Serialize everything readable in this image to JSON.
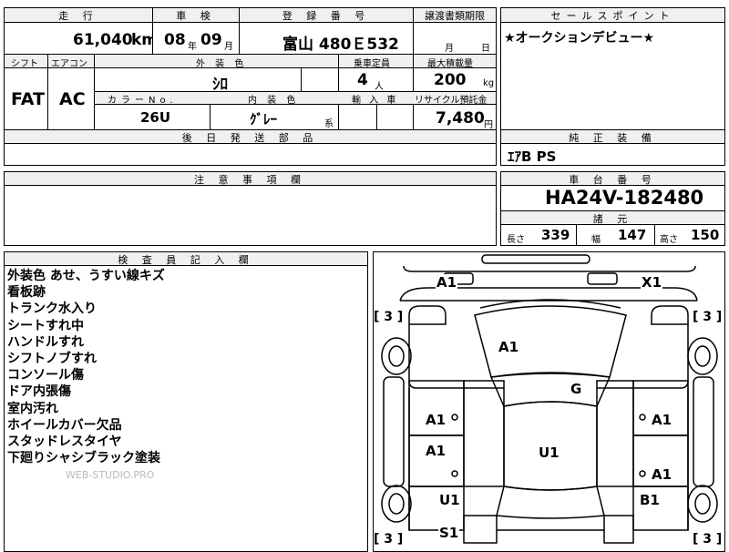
{
  "top_row": {
    "mileage_label": "走 行",
    "mileage_value": "61,040",
    "mileage_unit": "km",
    "inspection_label": "車 検",
    "insp_year": "08",
    "insp_year_unit": "年",
    "insp_month": "09",
    "insp_month_unit": "月",
    "registration_label": "登 録 番 号",
    "registration_value": "富山 480Ｅ532",
    "transfer_label": "譲渡書類期限",
    "transfer_month_unit": "月",
    "transfer_day_unit": "日"
  },
  "sales_points": {
    "label": "セールスポイント",
    "text": "★オークションデビュー★"
  },
  "second_block": {
    "shift_label": "シフト",
    "shift_value": "FAT",
    "ac_label": "エアコン",
    "ac_value": "AC",
    "ext_color_label": "外 装 色",
    "ext_color_value": "ｼﾛ",
    "capacity_label": "乗車定員",
    "capacity_value": "4",
    "capacity_unit": "人",
    "load_label": "最大積載量",
    "load_value": "200",
    "load_unit": "kg",
    "color_no_label": "カラーNo.",
    "color_no_value": "26U",
    "int_color_label": "内 装 色",
    "int_color_value": "ｸﾞﾚｰ",
    "int_color_suffix": "系",
    "import_label": "輸 入 車",
    "recycle_label": "リサイクル預託金",
    "recycle_value": "7,480",
    "recycle_unit": "円"
  },
  "parts": {
    "label": "後 日 発 送 部 品"
  },
  "equipment": {
    "label": "純 正 装 備",
    "value": "ｴｱB PS"
  },
  "caution": {
    "label": "注 意 事 項 欄"
  },
  "chassis": {
    "label": "車 台 番 号",
    "value": "HA24V-182480"
  },
  "specs": {
    "label": "諸 元",
    "length_label": "長さ",
    "length_value": "339",
    "width_label": "幅",
    "width_value": "147",
    "height_label": "高さ",
    "height_value": "150"
  },
  "inspector": {
    "label": "検 査 員 記 入 欄",
    "notes": [
      "外装色 あせ、うすい線キズ",
      "看板跡",
      "トランク水入り",
      "シートすれ中",
      "ハンドルすれ",
      "シフトノブすれ",
      "コンソール傷",
      "ドア内張傷",
      "室内汚れ",
      "ホイールカバー欠品",
      "スタッドレスタイヤ",
      "下廻りシャシブラック塗装"
    ],
    "watermark": "WEB-STUDIO.PRO"
  },
  "diagram": {
    "grades": {
      "front_left": "A1",
      "front_right": "X1",
      "hood": "A1",
      "windshield": "G",
      "front_door_left": "A1",
      "front_door_right": "A1",
      "rear_door_left": "A1",
      "rear_door_right": "A1",
      "roof": "U1",
      "rear_quarter_left": "U1",
      "rear_quarter_right": "B1",
      "rear_left": "S1"
    },
    "tire_brackets": {
      "front_left": "[ 3 ]",
      "front_right": "[ 3 ]",
      "rear_left": "[ 3 ]",
      "rear_right": "[ 3 ]"
    }
  }
}
